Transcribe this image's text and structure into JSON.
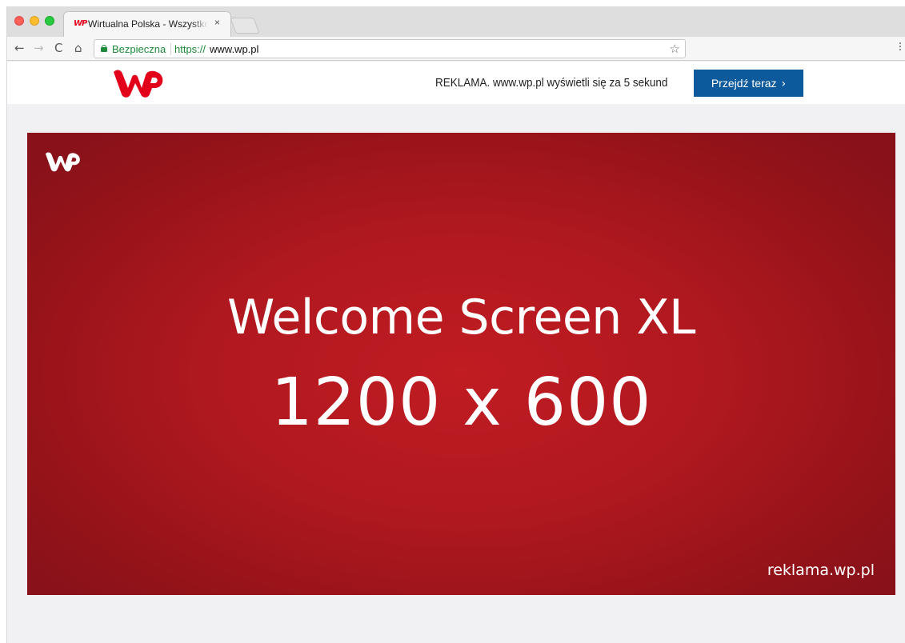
{
  "browser": {
    "tab": {
      "title": "Wirtualna Polska - Wszystko co",
      "favicon_text": "WP",
      "close_glyph": "×"
    },
    "toolbar": {
      "back_glyph": "←",
      "forward_glyph": "→",
      "reload_glyph": "C",
      "home_glyph": "⌂",
      "star_glyph": "☆",
      "menu_glyph": "⋮"
    },
    "omnibox": {
      "security_label": "Bezpieczna",
      "url_scheme": "https://",
      "url_host": "www.wp.pl"
    }
  },
  "page": {
    "header": {
      "ad_notice": "REKLAMA. www.wp.pl wyświetli się za 5 sekund",
      "skip_button_label": "Przejdź teraz",
      "skip_button_chevron": "›",
      "skip_button_color": "#0c5a9c"
    },
    "banner": {
      "title": "Welcome Screen XL",
      "size": "1200 x 600",
      "footer_url": "reklama.wp.pl",
      "background_color": "#b0181f"
    },
    "brand": {
      "logo_color": "#e3001b"
    }
  }
}
